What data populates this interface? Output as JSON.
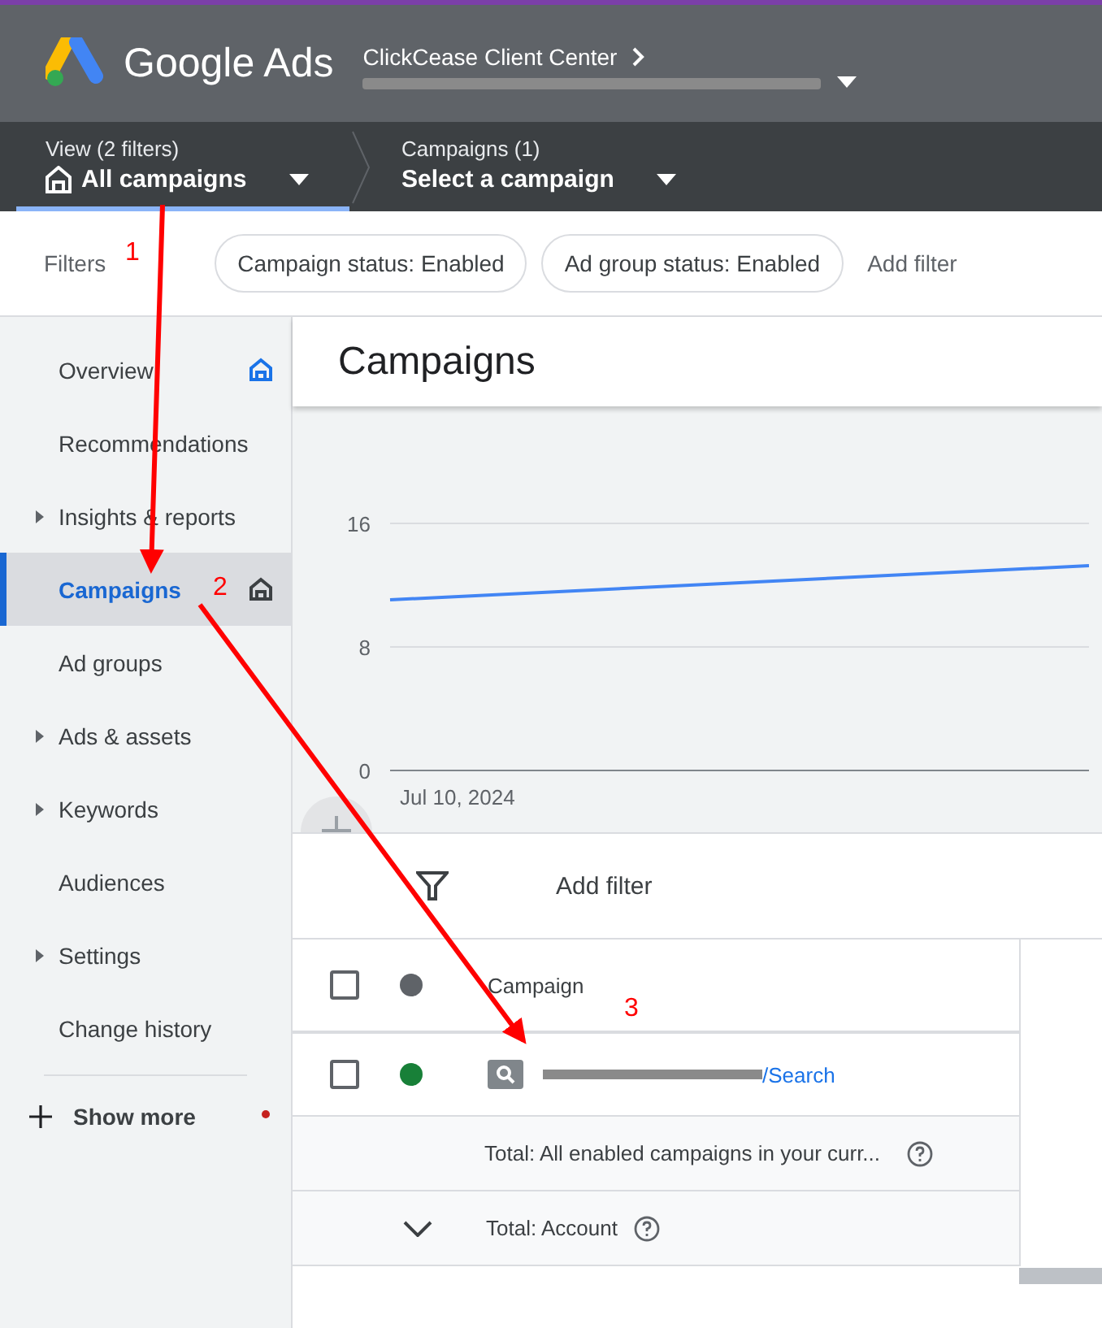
{
  "header": {
    "product": "Google Ads",
    "account_parent": "ClickCease Client Center"
  },
  "selectors": [
    {
      "label": "View (2 filters)",
      "value": "All campaigns",
      "selected": true
    },
    {
      "label": "Campaigns (1)",
      "value": "Select a campaign",
      "selected": false
    }
  ],
  "filters": {
    "label": "Filters",
    "chips": [
      "Campaign status: Enabled",
      "Ad group status: Enabled"
    ],
    "add": "Add filter"
  },
  "sidebar": {
    "items": [
      {
        "label": "Overview",
        "expandable": false,
        "selected": false,
        "pinned": true
      },
      {
        "label": "Recommendations",
        "expandable": false,
        "selected": false,
        "pinned": false
      },
      {
        "label": "Insights & reports",
        "expandable": true,
        "selected": false,
        "pinned": false
      },
      {
        "label": "Campaigns",
        "expandable": false,
        "selected": true,
        "pinned": true
      },
      {
        "label": "Ad groups",
        "expandable": false,
        "selected": false,
        "pinned": false
      },
      {
        "label": "Ads & assets",
        "expandable": true,
        "selected": false,
        "pinned": false
      },
      {
        "label": "Keywords",
        "expandable": true,
        "selected": false,
        "pinned": false
      },
      {
        "label": "Audiences",
        "expandable": false,
        "selected": false,
        "pinned": false
      },
      {
        "label": "Settings",
        "expandable": true,
        "selected": false,
        "pinned": false
      },
      {
        "label": "Change history",
        "expandable": false,
        "selected": false,
        "pinned": false
      }
    ],
    "show_more": "Show more",
    "show_more_dot": true
  },
  "page_title": "Campaigns",
  "chart": {
    "y_labels": [
      "16",
      "8",
      "0"
    ],
    "start_label": "Jul 10, 2024"
  },
  "table": {
    "add_filter": "Add filter",
    "column_header": "Campaign",
    "header_checked": false,
    "rows": [
      {
        "kind": "campaign",
        "name_suffix": "/Search",
        "checked": false,
        "enabled": true
      },
      {
        "kind": "total",
        "text": "Total: All enabled campaigns in your curr..."
      },
      {
        "kind": "account",
        "text": "Total: Account"
      }
    ]
  },
  "annotations": [
    {
      "number": "1"
    },
    {
      "number": "2"
    },
    {
      "number": "3"
    }
  ]
}
